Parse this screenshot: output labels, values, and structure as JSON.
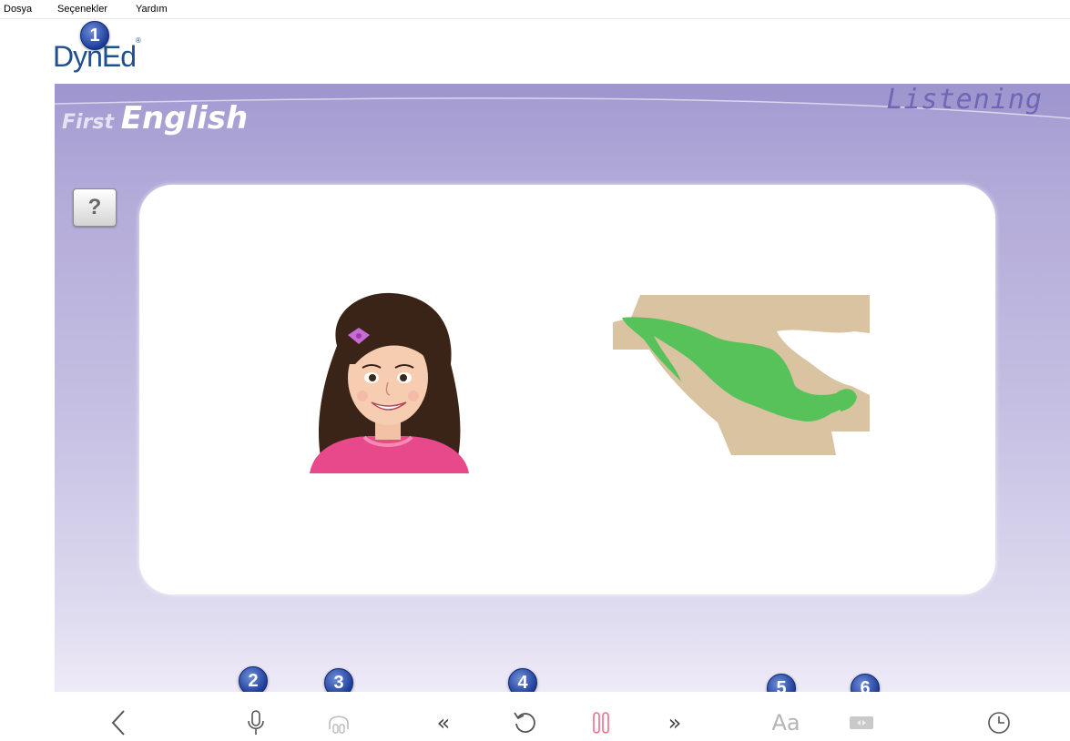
{
  "menubar": {
    "items": [
      {
        "label": "Dosya"
      },
      {
        "label": "Seçenekler"
      },
      {
        "label": "Yardım"
      }
    ]
  },
  "logo": {
    "text": "DynEd",
    "mark": "®"
  },
  "header": {
    "title_first": "First",
    "title_english": "English",
    "mode": "Listening"
  },
  "help": {
    "label": "?"
  },
  "images": {
    "left": "girl-illustration",
    "right": "mexico-map"
  },
  "badges": [
    "1",
    "2",
    "3",
    "4",
    "5",
    "6"
  ],
  "toolbar": {
    "back_icon": "chevron-left-icon",
    "record_icon": "microphone-icon",
    "playback_icon": "headphones-icon",
    "rewind_label": "«",
    "repeat_icon": "repeat-icon",
    "pause_icon": "pause-icon",
    "forward_label": "»",
    "text_label": "Aa",
    "keyboard_icon": "keyboard-icon",
    "clock_icon": "clock-icon"
  },
  "colors": {
    "badge": "#1c3c9a",
    "pause": "#f46b87",
    "stage_top": "#a39bd1",
    "listening": "#6f67b3"
  }
}
